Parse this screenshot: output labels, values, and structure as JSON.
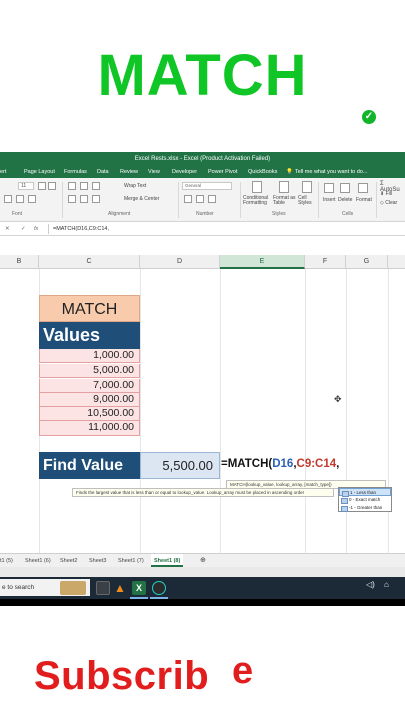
{
  "title": "MATCH",
  "window": {
    "title": "Excel Rests.xlsx - Excel (Product Activation Failed)"
  },
  "menu": [
    "ert",
    "Page Layout",
    "Formulas",
    "Data",
    "Review",
    "View",
    "Developer",
    "Power Pivot",
    "QuickBooks"
  ],
  "tell_me": "Tell me what you want to do...",
  "ribbon": {
    "font_size": "11",
    "wrap_text": "Wrap Text",
    "merge_center": "Merge & Center",
    "number_format": "General",
    "conditional_formatting": "Conditional Formatting",
    "format_as_table": "Format as Table",
    "cell_styles": "Cell Styles",
    "insert": "Insert",
    "delete": "Delete",
    "format": "Format",
    "autosum": "AutoSu",
    "fill": "Fill",
    "clear": "Clear",
    "groups": [
      "Font",
      "Alignment",
      "Number",
      "Styles",
      "Cells"
    ]
  },
  "formula_bar": {
    "cancel": "✕",
    "enter": "✓",
    "fx": "fx",
    "content": "=MATCH(D16,C9:C14,"
  },
  "columns": [
    "B",
    "C",
    "D",
    "E",
    "F",
    "G"
  ],
  "cells": {
    "match_label": "MATCH",
    "values_label": "Values",
    "values": [
      "1,000.00",
      "5,000.00",
      "7,000.00",
      "9,000.00",
      "10,500.00",
      "11,000.00"
    ],
    "find_label": "Find Value",
    "find_value": "5,500.00",
    "formula_prefix": "=MATCH(",
    "formula_ref1": "D16",
    "formula_sep": ",",
    "formula_ref2": "C9:C14",
    "formula_suffix": ","
  },
  "tooltip_syntax": "MATCH(lookup_value, lookup_array, [match_type])",
  "tooltip_desc": "Finds the largest value that is less than or equal to lookup_value. Lookup_array must be placed in ascending order",
  "autocomplete": [
    "1 - Less than",
    "0 - Exact match",
    "-1 - Greater than"
  ],
  "sheets": [
    "t1 (5)",
    "Sheet1 (6)",
    "Sheet2",
    "Sheet3",
    "Sheet1 (7)",
    "Sheet1 (8)"
  ],
  "add_sheet": "⊕",
  "taskbar": {
    "search_text": "e to search"
  },
  "subscribe": "Subscrib",
  "subscribe_e": "e"
}
